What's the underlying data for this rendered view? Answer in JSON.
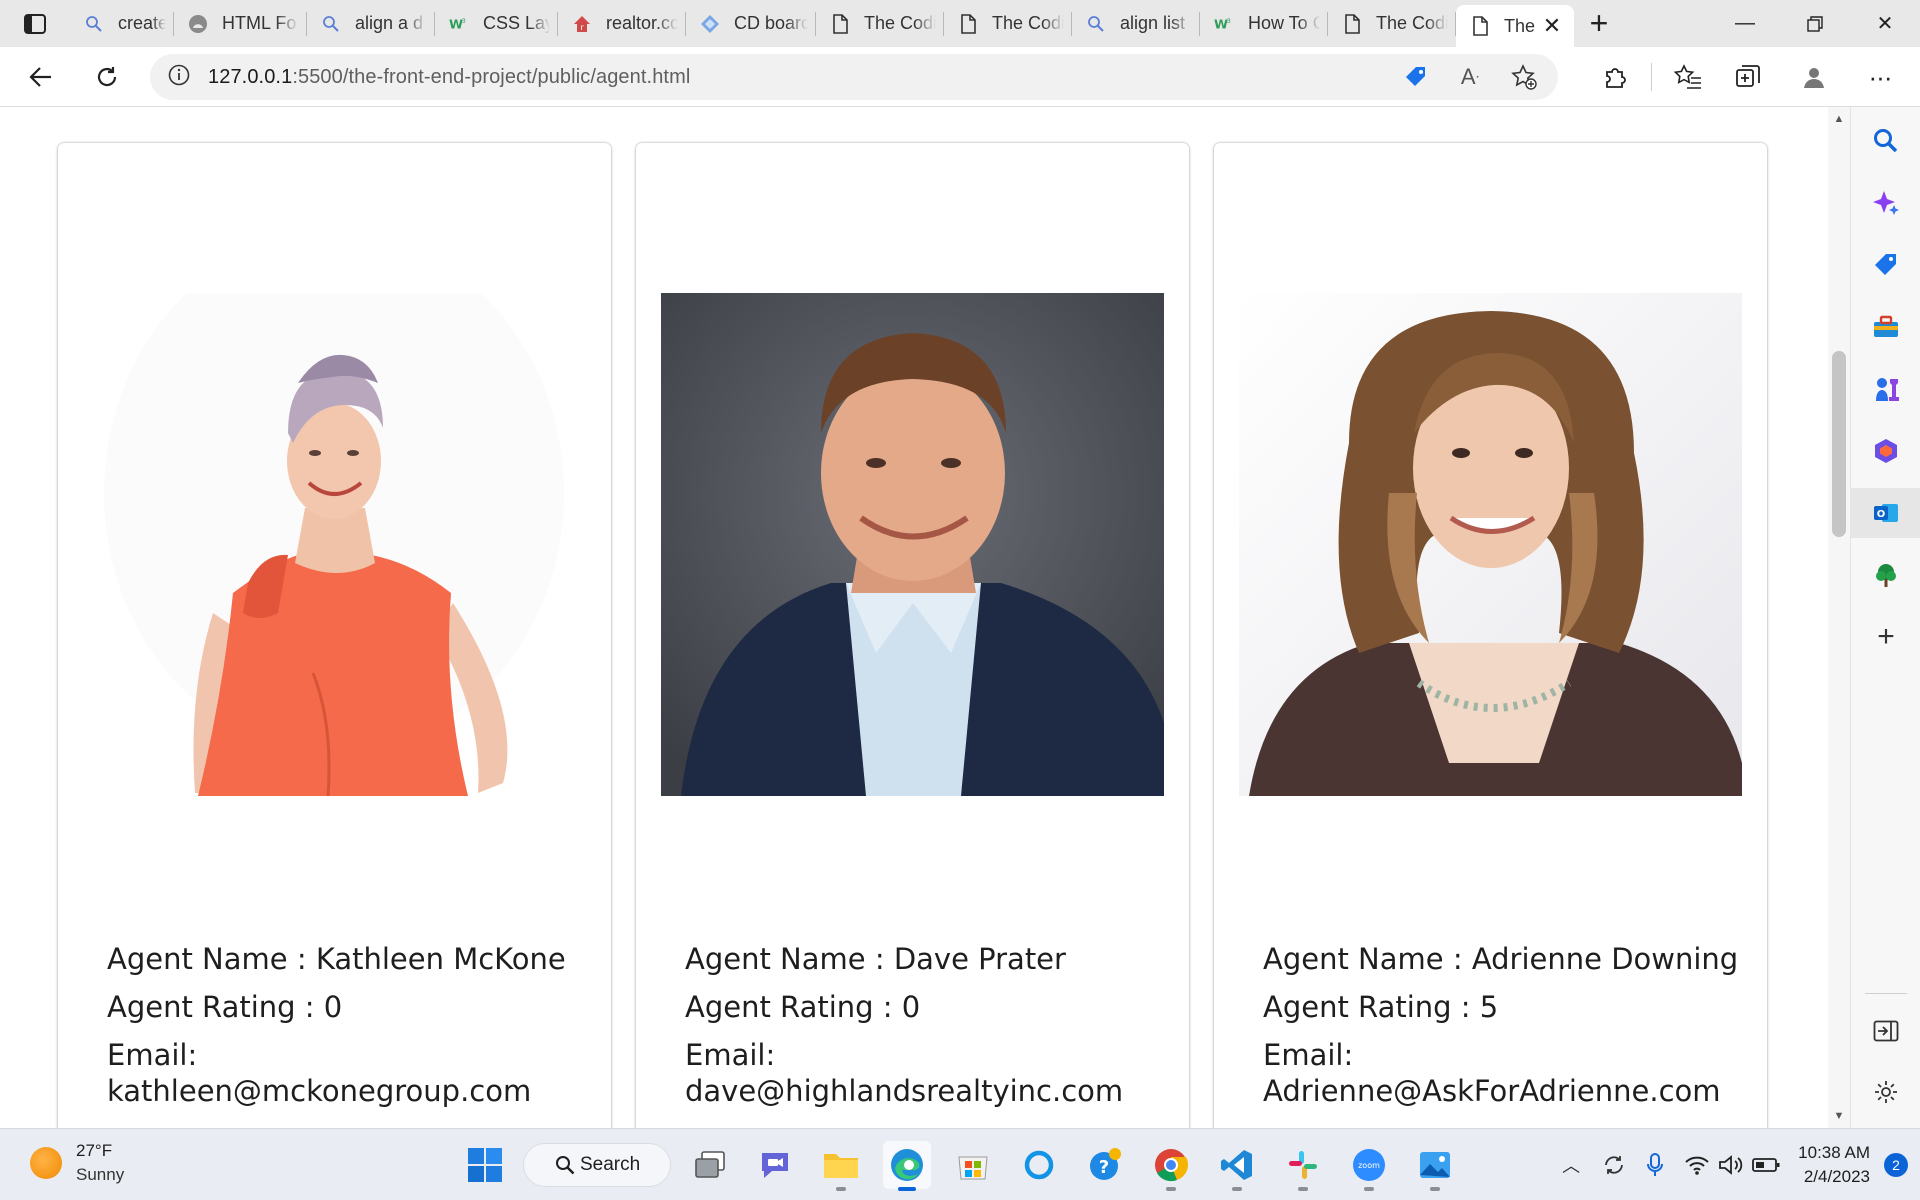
{
  "browser": {
    "tabs": [
      {
        "title": "create fo",
        "icon": "search-icon"
      },
      {
        "title": "HTML Fo",
        "icon": "github-icon"
      },
      {
        "title": "align a d",
        "icon": "search-icon"
      },
      {
        "title": "CSS Layo",
        "icon": "w3schools-icon"
      },
      {
        "title": "realtor.cc",
        "icon": "realtor-icon"
      },
      {
        "title": "CD boarc",
        "icon": "diamond-icon"
      },
      {
        "title": "The Codi",
        "icon": "page-icon"
      },
      {
        "title": "The Codi",
        "icon": "page-icon"
      },
      {
        "title": "align list",
        "icon": "search-icon"
      },
      {
        "title": "How To C",
        "icon": "w3schools-icon"
      },
      {
        "title": "The Codi",
        "icon": "page-icon"
      }
    ],
    "active_tab": {
      "title": "The",
      "icon": "page-icon"
    },
    "url": {
      "host": "127.0.0.1",
      "rest": ":5500/the-front-end-project/public/agent.html"
    }
  },
  "agents": [
    {
      "name_line": "Agent Name : Kathleen McKone",
      "rating_line": "Agent Rating : 0",
      "email_label": "Email:",
      "email": "kathleen@mckonegroup.com"
    },
    {
      "name_line": "Agent Name : Dave Prater",
      "rating_line": "Agent Rating : 0",
      "email_label": "Email:",
      "email": "dave@highlandsrealtyinc.com"
    },
    {
      "name_line": "Agent Name : Adrienne Downing",
      "rating_line": "Agent Rating : 5",
      "email_label": "Email:",
      "email": "Adrienne@AskForAdrienne.com"
    }
  ],
  "taskbar": {
    "weather": {
      "temp": "27°F",
      "condition": "Sunny"
    },
    "search_label": "Search",
    "time": "10:38 AM",
    "date": "2/4/2023",
    "notifications": "2"
  },
  "colors": {
    "accent": "#0a64d8",
    "page_bg": "#ffffff"
  }
}
